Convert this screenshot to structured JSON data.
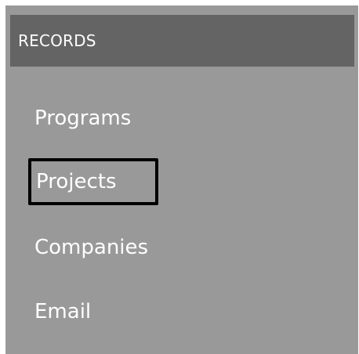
{
  "section": {
    "title": "RECORDS"
  },
  "menu": {
    "items": [
      {
        "label": "Programs"
      },
      {
        "label": "Projects",
        "selected": true
      },
      {
        "label": "Companies"
      },
      {
        "label": "Email"
      }
    ]
  }
}
